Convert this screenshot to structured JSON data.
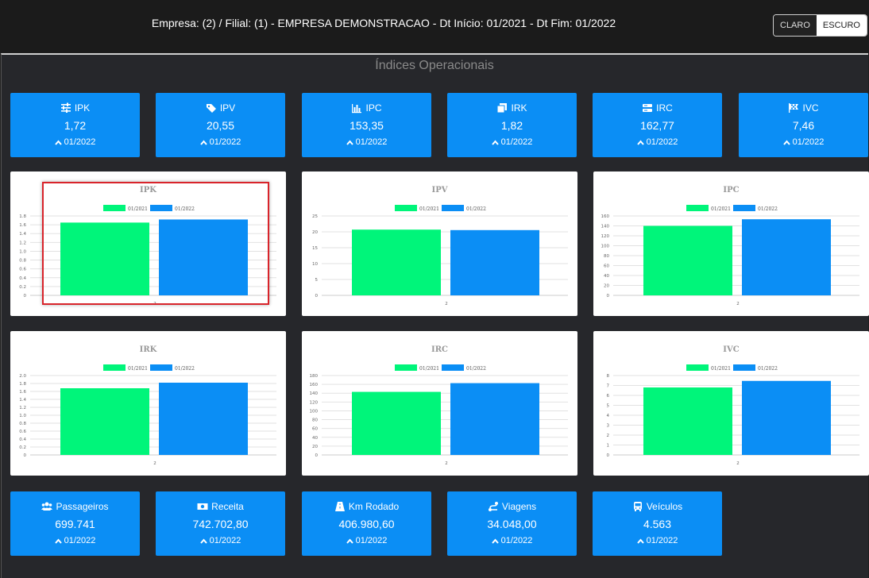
{
  "header": {
    "title": "Empresa: (2) / Filial: (1) - EMPRESA DEMONSTRACAO - Dt Início: 01/2021 - Dt Fim: 01/2022",
    "theme_light": "CLARO",
    "theme_dark": "ESCURO"
  },
  "page_title": "Índices Operacionais",
  "colors": {
    "accent": "#0b8ef5",
    "series_2021": "#00f57a",
    "series_2022": "#0b8ef5",
    "background": "#26272b",
    "highlight": "#d9242b"
  },
  "index_cards": [
    {
      "label": "IPK",
      "value": "1,72",
      "period": "01/2022",
      "icon": "sliders-icon"
    },
    {
      "label": "IPV",
      "value": "20,55",
      "period": "01/2022",
      "icon": "tags-icon"
    },
    {
      "label": "IPC",
      "value": "153,35",
      "period": "01/2022",
      "icon": "chart-bar-icon"
    },
    {
      "label": "IRK",
      "value": "1,82",
      "period": "01/2022",
      "icon": "copy-icon"
    },
    {
      "label": "IRC",
      "value": "162,77",
      "period": "01/2022",
      "icon": "server-icon"
    },
    {
      "label": "IVC",
      "value": "7,46",
      "period": "01/2022",
      "icon": "flag-checkered-icon"
    }
  ],
  "total_cards": [
    {
      "label": "Passageiros",
      "value": "699.741",
      "period": "01/2022",
      "icon": "users-icon"
    },
    {
      "label": "Receita",
      "value": "742.702,80",
      "period": "01/2022",
      "icon": "money-bill-icon"
    },
    {
      "label": "Km Rodado",
      "value": "406.980,60",
      "period": "01/2022",
      "icon": "road-icon"
    },
    {
      "label": "Viagens",
      "value": "34.048,00",
      "period": "01/2022",
      "icon": "route-icon"
    },
    {
      "label": "Veículos",
      "value": "4.563",
      "period": "01/2022",
      "icon": "bus-icon"
    }
  ],
  "chart_data": [
    {
      "type": "bar",
      "title": "IPK",
      "categories": [
        "2"
      ],
      "series": [
        {
          "name": "01/2021",
          "values": [
            1.65
          ]
        },
        {
          "name": "01/2022",
          "values": [
            1.72
          ]
        }
      ],
      "ylim": [
        0,
        1.8
      ],
      "yticks": [
        "0",
        "0.2",
        "0.4",
        "0.6",
        "0.8",
        "1.0",
        "1.2",
        "1.4",
        "1.6",
        "1.8"
      ],
      "grid": true,
      "legend": "top"
    },
    {
      "type": "bar",
      "title": "IPV",
      "categories": [
        "2"
      ],
      "series": [
        {
          "name": "01/2021",
          "values": [
            20.7
          ]
        },
        {
          "name": "01/2022",
          "values": [
            20.55
          ]
        }
      ],
      "ylim": [
        0,
        25
      ],
      "yticks": [
        "0",
        "5",
        "10",
        "15",
        "20",
        "25"
      ],
      "grid": true,
      "legend": "top"
    },
    {
      "type": "bar",
      "title": "IPC",
      "categories": [
        "2"
      ],
      "series": [
        {
          "name": "01/2021",
          "values": [
            140
          ]
        },
        {
          "name": "01/2022",
          "values": [
            153.35
          ]
        }
      ],
      "ylim": [
        0,
        160
      ],
      "yticks": [
        "0",
        "20",
        "40",
        "60",
        "80",
        "100",
        "120",
        "140",
        "160"
      ],
      "grid": true,
      "legend": "top"
    },
    {
      "type": "bar",
      "title": "IRK",
      "categories": [
        "2"
      ],
      "series": [
        {
          "name": "01/2021",
          "values": [
            1.68
          ]
        },
        {
          "name": "01/2022",
          "values": [
            1.82
          ]
        }
      ],
      "ylim": [
        0,
        2.0
      ],
      "yticks": [
        "0",
        "0.2",
        "0.4",
        "0.6",
        "0.8",
        "1.0",
        "1.2",
        "1.4",
        "1.6",
        "1.8",
        "2.0"
      ],
      "grid": true,
      "legend": "top"
    },
    {
      "type": "bar",
      "title": "IRC",
      "categories": [
        "2"
      ],
      "series": [
        {
          "name": "01/2021",
          "values": [
            143
          ]
        },
        {
          "name": "01/2022",
          "values": [
            162.77
          ]
        }
      ],
      "ylim": [
        0,
        180
      ],
      "yticks": [
        "0",
        "20",
        "40",
        "60",
        "80",
        "100",
        "120",
        "140",
        "160",
        "180"
      ],
      "grid": true,
      "legend": "top"
    },
    {
      "type": "bar",
      "title": "IVC",
      "categories": [
        "2"
      ],
      "series": [
        {
          "name": "01/2021",
          "values": [
            6.8
          ]
        },
        {
          "name": "01/2022",
          "values": [
            7.46
          ]
        }
      ],
      "ylim": [
        0,
        8
      ],
      "yticks": [
        "0",
        "1",
        "2",
        "3",
        "4",
        "5",
        "6",
        "7",
        "8"
      ],
      "grid": true,
      "legend": "top"
    }
  ]
}
